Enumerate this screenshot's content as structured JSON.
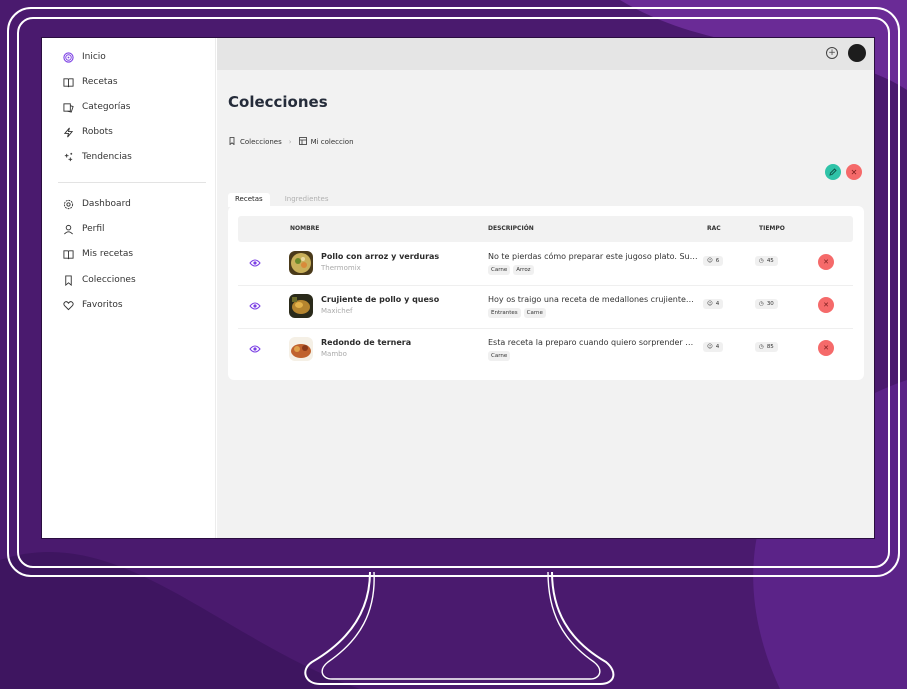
{
  "colors": {
    "background": "#4a1a6e",
    "accent": "#7b3fe4",
    "edit": "#2fc3a8",
    "danger": "#f56a6a"
  },
  "sidebar": {
    "primary": [
      {
        "label": "Inicio",
        "icon": "fingerprint-icon"
      },
      {
        "label": "Recetas",
        "icon": "book-icon"
      },
      {
        "label": "Categorías",
        "icon": "categories-icon"
      },
      {
        "label": "Robots",
        "icon": "bolt-icon"
      },
      {
        "label": "Tendencias",
        "icon": "sparkles-icon"
      }
    ],
    "secondary": [
      {
        "label": "Dashboard",
        "icon": "gear-icon"
      },
      {
        "label": "Perfil",
        "icon": "user-icon"
      },
      {
        "label": "Mis recetas",
        "icon": "book-icon"
      },
      {
        "label": "Colecciones",
        "icon": "bookmark-icon"
      },
      {
        "label": "Favoritos",
        "icon": "heart-icon"
      }
    ]
  },
  "page": {
    "title": "Colecciones",
    "breadcrumb": [
      "Colecciones",
      "Mi coleccion"
    ]
  },
  "tabs": [
    "Recetas",
    "Ingredientes"
  ],
  "table": {
    "headers": [
      "NOMBRE",
      "DESCRIPCIÓN",
      "RAC",
      "TIEMPO"
    ],
    "rows": [
      {
        "name": "Pollo con arroz y verduras",
        "robot": "Thermomix",
        "description": "No te pierdas cómo preparar este jugoso plato. Su ...",
        "tags": [
          "Carne",
          "Arroz"
        ],
        "rac": "6",
        "time": "45"
      },
      {
        "name": "Crujiente de pollo y queso",
        "robot": "Maxichef",
        "description": "Hoy os traigo una receta de medallones crujientes ...",
        "tags": [
          "Entrantes",
          "Carne"
        ],
        "rac": "4",
        "time": "30"
      },
      {
        "name": "Redondo de ternera",
        "robot": "Mambo",
        "description": "Esta receta la preparo cuando quiero sorprender a ...",
        "tags": [
          "Carne"
        ],
        "rac": "4",
        "time": "85"
      }
    ]
  }
}
